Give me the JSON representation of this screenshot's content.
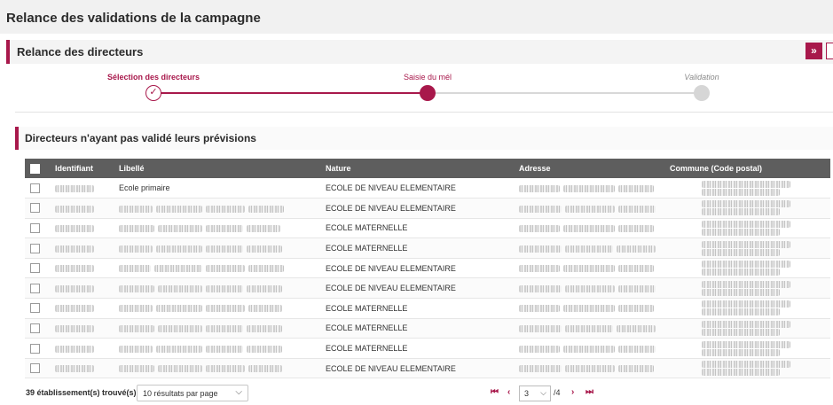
{
  "page": {
    "title": "Relance des validations de la campagne"
  },
  "section": {
    "title": "Relance des directeurs",
    "collapse_icon": "double-chevron-right-icon",
    "collapse_label": "»"
  },
  "stepper": {
    "steps": [
      {
        "label": "Sélection des directeurs",
        "state": "done"
      },
      {
        "label": "Saisie du mél",
        "state": "current"
      },
      {
        "label": "Validation",
        "state": "todo"
      }
    ],
    "check_glyph": "✓",
    "accent": "#a8184b"
  },
  "subsection": {
    "title": "Directeurs n'ayant pas validé leurs prévisions"
  },
  "table": {
    "headers": [
      "Identifiant",
      "Libellé",
      "Nature",
      "Adresse",
      "Commune (Code postal)"
    ],
    "rows": [
      {
        "libelle": "Ecole primaire",
        "nature": "ECOLE DE NIVEAU ELEMENTAIRE"
      },
      {
        "libelle": "",
        "nature": "ECOLE DE NIVEAU ELEMENTAIRE"
      },
      {
        "libelle": "",
        "nature": "ECOLE MATERNELLE"
      },
      {
        "libelle": "",
        "nature": "ECOLE MATERNELLE"
      },
      {
        "libelle": "",
        "nature": "ECOLE DE NIVEAU ELEMENTAIRE"
      },
      {
        "libelle": "",
        "nature": "ECOLE DE NIVEAU ELEMENTAIRE"
      },
      {
        "libelle": "",
        "nature": "ECOLE MATERNELLE"
      },
      {
        "libelle": "",
        "nature": "ECOLE MATERNELLE"
      },
      {
        "libelle": "",
        "nature": "ECOLE MATERNELLE"
      },
      {
        "libelle": "",
        "nature": "ECOLE DE NIVEAU ELEMENTAIRE"
      }
    ]
  },
  "footer": {
    "count": "39 établissement(s) trouvé(s)",
    "per_page": "10 résultats par page",
    "pager": {
      "first": "⏮",
      "prev": "‹",
      "current_page": "3",
      "total": "/4",
      "next": "›",
      "last": "⏭"
    }
  }
}
